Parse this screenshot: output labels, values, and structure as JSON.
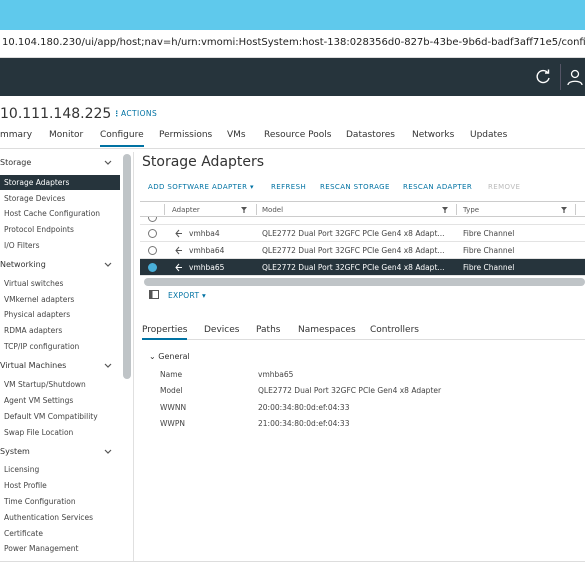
{
  "browser": {
    "url": "10.104.180.230/ui/app/host;nav=h/urn:vmomi:HostSystem:host-138:028356d0-827b-43be-9b6d-badf3aff71e5/configu"
  },
  "object": {
    "title": "10.111.148.225",
    "actions_label": "ACTIONS"
  },
  "tabs": [
    {
      "label": "mmary"
    },
    {
      "label": "Monitor"
    },
    {
      "label": "Configure"
    },
    {
      "label": "Permissions"
    },
    {
      "label": "VMs"
    },
    {
      "label": "Resource Pools"
    },
    {
      "label": "Datastores"
    },
    {
      "label": "Networks"
    },
    {
      "label": "Updates"
    }
  ],
  "sidebar": {
    "groups": [
      {
        "label": "Storage",
        "items": [
          "Storage Adapters",
          "Storage Devices",
          "Host Cache Configuration",
          "Protocol Endpoints",
          "I/O Filters"
        ]
      },
      {
        "label": "Networking",
        "items": [
          "Virtual switches",
          "VMkernel adapters",
          "Physical adapters",
          "RDMA adapters",
          "TCP/IP configuration"
        ]
      },
      {
        "label": "Virtual Machines",
        "items": [
          "VM Startup/Shutdown",
          "Agent VM Settings",
          "Default VM Compatibility",
          "Swap File Location"
        ]
      },
      {
        "label": "System",
        "items": [
          "Licensing",
          "Host Profile",
          "Time Configuration",
          "Authentication Services",
          "Certificate",
          "Power Management"
        ]
      }
    ]
  },
  "panel": {
    "title": "Storage Adapters",
    "toolbar": {
      "add": "ADD SOFTWARE ADAPTER",
      "refresh": "REFRESH",
      "rescan_storage": "RESCAN STORAGE",
      "rescan_adapter": "RESCAN ADAPTER",
      "remove": "REMOVE"
    },
    "columns": [
      "Adapter",
      "Model",
      "Type"
    ],
    "rows": [
      {
        "adapter": "vmhba4",
        "model": "QLE2772 Dual Port 32GFC PCIe Gen4 x8 Adapt...",
        "type": "Fibre Channel"
      },
      {
        "adapter": "vmhba64",
        "model": "QLE2772 Dual Port 32GFC PCIe Gen4 x8 Adapt...",
        "type": "Fibre Channel"
      },
      {
        "adapter": "vmhba65",
        "model": "QLE2772 Dual Port 32GFC PCIe Gen4 x8 Adapt...",
        "type": "Fibre Channel"
      }
    ],
    "export_label": "EXPORT",
    "detail_tabs": [
      "Properties",
      "Devices",
      "Paths",
      "Namespaces",
      "Controllers"
    ],
    "general_label": "General",
    "properties": [
      {
        "name": "Name",
        "value": "vmhba65"
      },
      {
        "name": "Model",
        "value": "QLE2772 Dual Port 32GFC PCIe Gen4 x8 Adapter"
      },
      {
        "name": "WWNN",
        "value": "20:00:34:80:0d:ef:04:33"
      },
      {
        "name": "WWPN",
        "value": "21:00:34:80:0d:ef:04:33"
      }
    ]
  },
  "colors": {
    "header": "#26343c",
    "accent": "#0072a3",
    "browser": "#5fc9ec",
    "selected": "#26343c"
  }
}
